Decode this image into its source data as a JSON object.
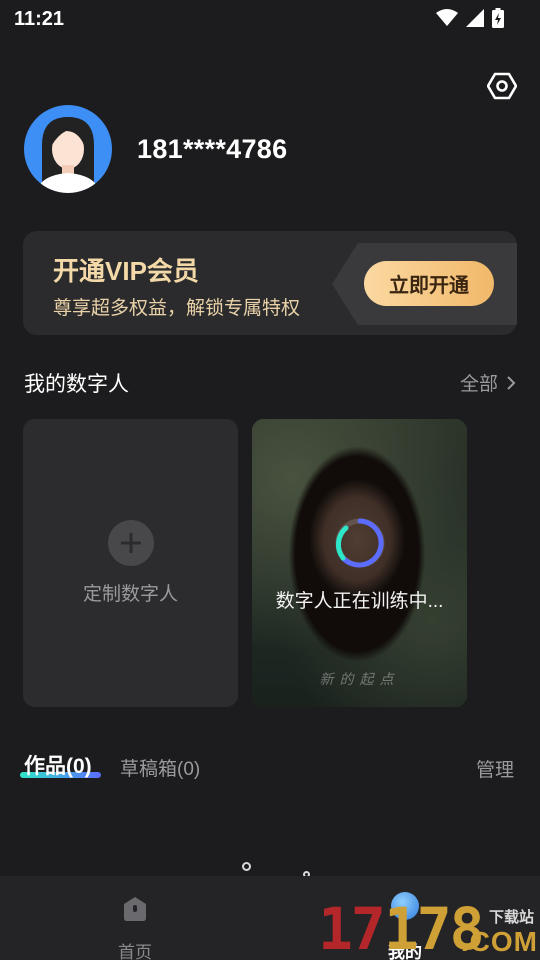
{
  "status_bar": {
    "time": "11:21"
  },
  "profile": {
    "username": "181****4786"
  },
  "vip": {
    "title": "开通VIP会员",
    "subtitle": "尊享超多权益，解锁专属特权",
    "button": "立即开通"
  },
  "digital_humans": {
    "title": "我的数字人",
    "all_label": "全部",
    "create_label": "定制数字人",
    "training_label": "数字人正在训练中...",
    "photo_caption": "新的起点"
  },
  "tabs": {
    "works": "作品(0)",
    "drafts": "草稿箱(0)",
    "manage": "管理"
  },
  "nav": {
    "home": "首页",
    "mine": "我的"
  },
  "watermark": {
    "digits_red": "17",
    "digits_gold": "178",
    "top": "下载站",
    "domain": ".COM"
  },
  "colors": {
    "background": "#1c1c1e",
    "card": "#2c2c2e",
    "vip_gold": "#f4d9a8",
    "tab_accent": "#2ee6c8",
    "spinner": "#5b6cff"
  },
  "icons": {
    "settings": "hexagon-gear-icon",
    "wifi": "wifi-icon",
    "signal": "cell-signal-icon",
    "battery": "battery-charging-icon",
    "add": "plus-icon",
    "chevron": "chevron-right-icon",
    "home": "home-icon"
  }
}
